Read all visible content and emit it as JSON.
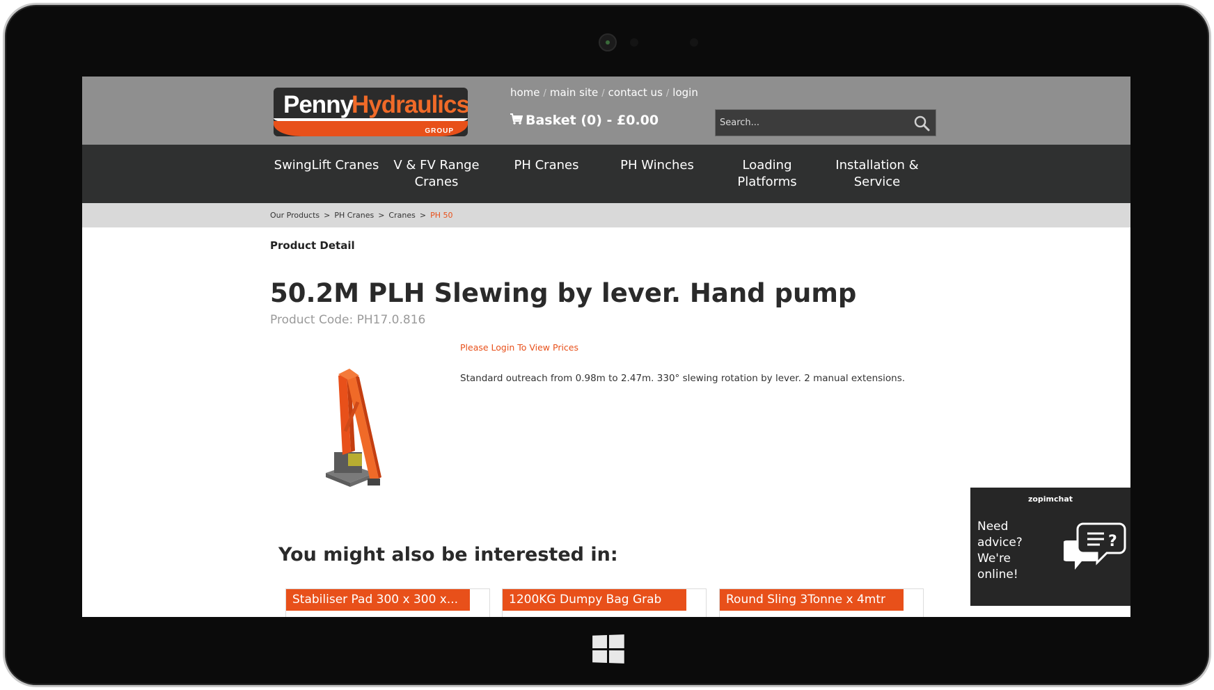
{
  "header": {
    "logo": {
      "word1": "Penny",
      "word2": "Hydraulics",
      "tagline": "GROUP"
    },
    "top_links": [
      {
        "label": "home"
      },
      {
        "label": "main site"
      },
      {
        "label": "contact us"
      },
      {
        "label": "login"
      }
    ],
    "basket_label": "Basket (0) - £0.00",
    "search": {
      "placeholder": "Search..."
    }
  },
  "nav": {
    "items": [
      {
        "label": "SwingLift Cranes"
      },
      {
        "label": "V & FV Range Cranes"
      },
      {
        "label": "PH Cranes"
      },
      {
        "label": "PH Winches"
      },
      {
        "label": "Loading Platforms"
      },
      {
        "label": "Installation & Service"
      }
    ]
  },
  "breadcrumb": {
    "items": [
      "Our Products",
      "PH Cranes",
      "Cranes"
    ],
    "separator": ">",
    "current": "PH 50"
  },
  "product": {
    "section_heading": "Product Detail",
    "title": "50.2M PLH Slewing by lever. Hand pump",
    "code": "Product Code: PH17.0.816",
    "login_prompt": "Please Login To View Prices",
    "description": "Standard outreach from 0.98m to 2.47m. 330° slewing rotation by lever. 2 manual extensions."
  },
  "related": {
    "title": "You might also be interested in:",
    "items": [
      {
        "label": "Stabiliser Pad 300 x 300 x..."
      },
      {
        "label": "1200KG Dumpy Bag Grab"
      },
      {
        "label": "Round Sling 3Tonne x 4mtr"
      }
    ]
  },
  "chat": {
    "brand": "zopimchat",
    "message": "Need advice? We're online!"
  },
  "colors": {
    "accent": "#e8501a",
    "header_bg": "#8f8f8f",
    "nav_bg": "#2f3030"
  }
}
